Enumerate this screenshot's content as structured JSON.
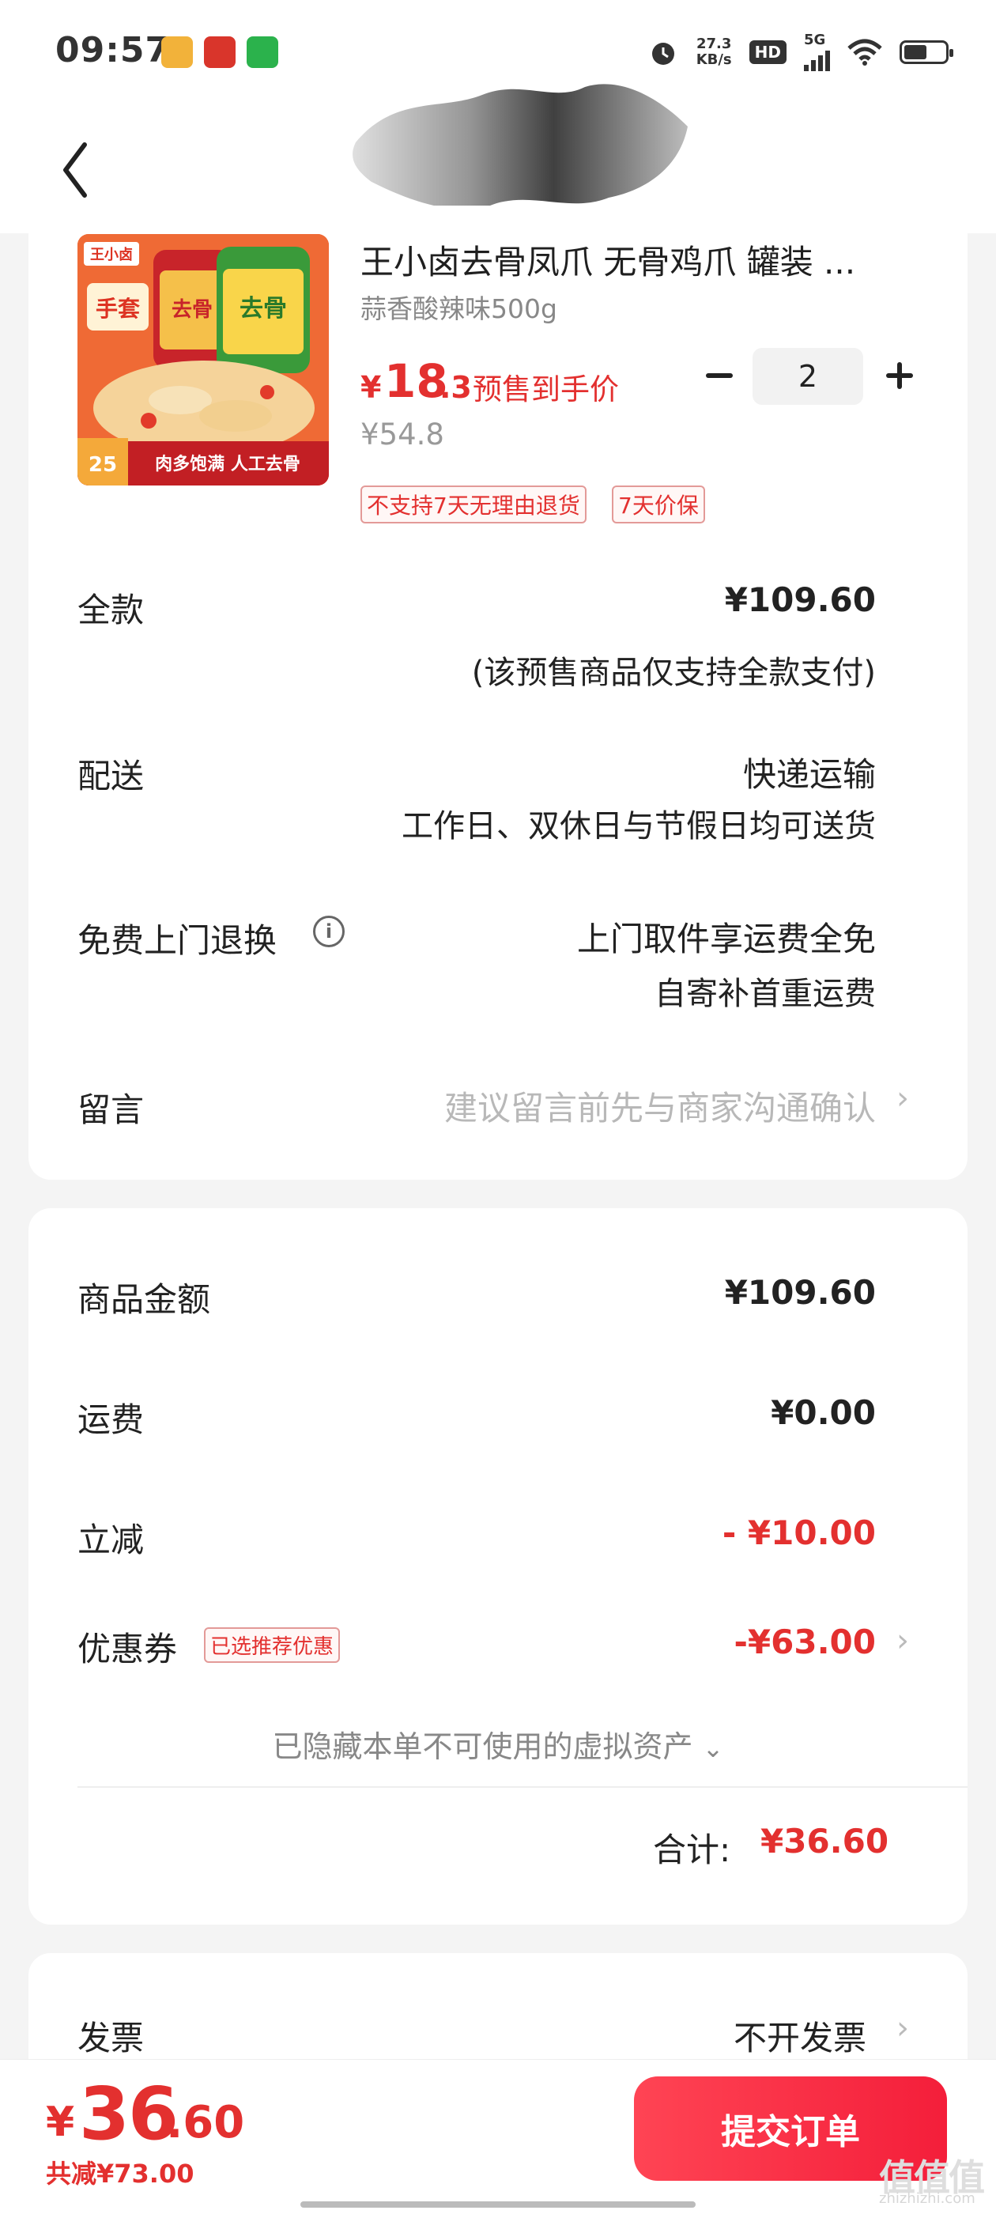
{
  "status_bar": {
    "time": "09:57",
    "net_speed_value": "27.3",
    "net_speed_unit": "KB/s",
    "hd_label": "HD",
    "network_label": "5G"
  },
  "nav": {
    "back_icon": "chevron-left-icon"
  },
  "product": {
    "name": "王小卤去骨凤爪 无骨鸡爪 罐装 ...",
    "variant": "蒜香酸辣味500g",
    "price_symbol": "¥",
    "price_int": "18",
    "price_dec": ".3",
    "presale_label": "预售到手价",
    "original_price": "¥54.8",
    "quantity": "2",
    "tags": [
      "不支持7天无理由退货",
      "7天价保"
    ],
    "image": {
      "brand": "王小卤",
      "jar_label_1": "去骨",
      "jar_label_2": "去骨",
      "banner": "肉多饱满 人工去骨",
      "badge": "手套",
      "corner_number": "25"
    }
  },
  "order": {
    "full_payment": {
      "label": "全款",
      "value": "¥109.60",
      "note": "(该预售商品仅支持全款支付)"
    },
    "delivery": {
      "label": "配送",
      "value": "快递运输",
      "note": "工作日、双休日与节假日均可送货"
    },
    "free_return": {
      "label": "免费上门退换",
      "info_icon": "info-icon",
      "value": "上门取件享运费全免",
      "note": "自寄补首重运费"
    },
    "message": {
      "label": "留言",
      "placeholder": "建议留言前先与商家沟通确认"
    }
  },
  "price_summary": {
    "goods_amount_label": "商品金额",
    "goods_amount_value": "¥109.60",
    "shipping_label": "运费",
    "shipping_value": "¥0.00",
    "discount_label": "立减",
    "discount_value": "- ¥10.00",
    "coupon_label": "优惠券",
    "coupon_badge": "已选推荐优惠",
    "coupon_value": "-¥63.00",
    "hidden_assets": "已隐藏本单不可使用的虚拟资产",
    "total_label": "合计:",
    "total_value": "¥36.60"
  },
  "invoice": {
    "label": "发票",
    "value": "不开发票"
  },
  "bottom_bar": {
    "symbol": "¥",
    "amount_int": "36",
    "amount_dec": ".60",
    "saved": "共减¥73.00",
    "submit_label": "提交订单"
  },
  "watermark": {
    "text": "值值值",
    "site": "zhizhizhi.com"
  },
  "colors": {
    "accent_red": "#e3302f",
    "button_gradient_start": "#ff4454",
    "button_gradient_end": "#f41e3a",
    "background": "#f4f4f4"
  }
}
